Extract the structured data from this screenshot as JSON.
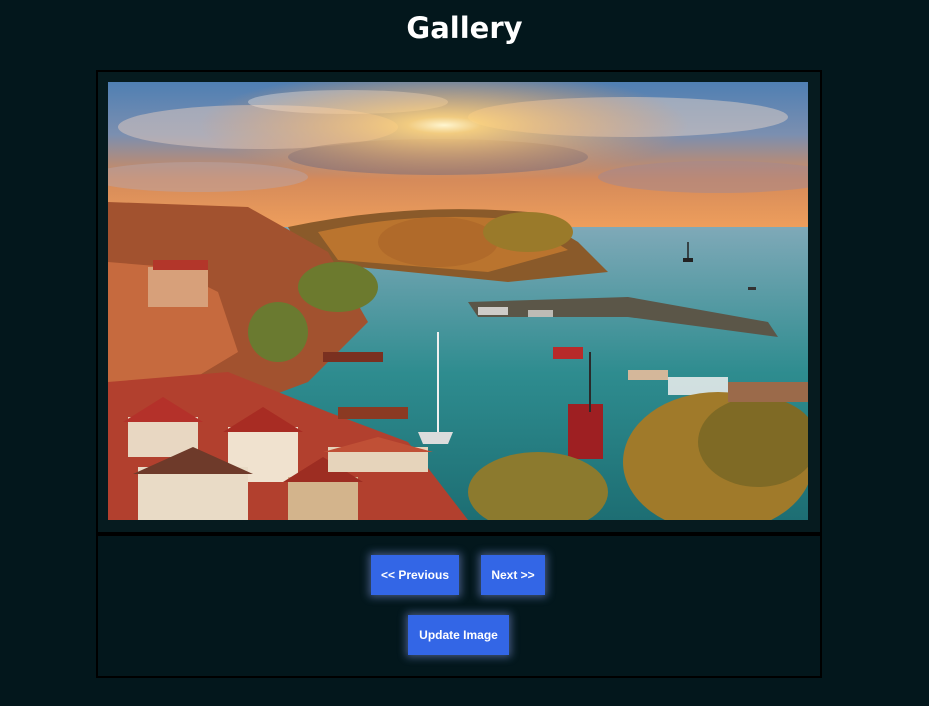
{
  "page": {
    "title": "Gallery"
  },
  "gallery": {
    "image_alt": "Coastal harbor town at sunset",
    "previous_label": "<< Previous",
    "next_label": "Next >>",
    "update_label": "Update Image"
  },
  "colors": {
    "background": "#03171c",
    "button": "#3366e6",
    "button_text": "#ffffff"
  }
}
